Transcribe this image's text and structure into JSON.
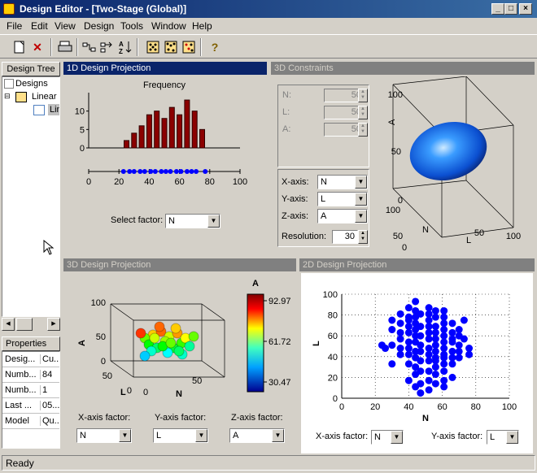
{
  "window": {
    "title": "Design Editor - [Two-Stage (Global)]",
    "minimize": "_",
    "maximize": "□",
    "close": "×"
  },
  "menu": [
    "File",
    "Edit",
    "View",
    "Design",
    "Tools",
    "Window",
    "Help"
  ],
  "tree": {
    "header": "Design Tree",
    "items": [
      "Designs",
      "Linear M",
      "Lin"
    ]
  },
  "properties": {
    "header": "Properties -...",
    "rows": [
      [
        "Desig...",
        "Cu..."
      ],
      [
        "Numb...",
        "84"
      ],
      [
        "Numb...",
        "1"
      ],
      [
        "Last ...",
        "05..."
      ],
      [
        "Model",
        "Qu..."
      ]
    ]
  },
  "panel_1d": {
    "title": "1D Design Projection",
    "select_label": "Select factor:",
    "select_value": "N"
  },
  "panel_3dc": {
    "title": "3D Constraints",
    "fields": [
      {
        "label": "N:",
        "value": "50"
      },
      {
        "label": "L:",
        "value": "50"
      },
      {
        "label": "A:",
        "value": "50"
      }
    ],
    "axes": [
      {
        "label": "X-axis:",
        "value": "N"
      },
      {
        "label": "Y-axis:",
        "value": "L"
      },
      {
        "label": "Z-axis:",
        "value": "A"
      }
    ],
    "resolution_label": "Resolution:",
    "resolution_value": "30"
  },
  "panel_3dp": {
    "title": "3D Design Projection",
    "factors": [
      {
        "label": "X-axis factor:",
        "value": "N"
      },
      {
        "label": "Y-axis factor:",
        "value": "L"
      },
      {
        "label": "Z-axis factor:",
        "value": "A"
      }
    ]
  },
  "panel_2dp": {
    "title": "2D Design Projection",
    "factors": [
      {
        "label": "X-axis factor:",
        "value": "N"
      },
      {
        "label": "Y-axis factor:",
        "value": "L"
      }
    ]
  },
  "status": "Ready",
  "colors": {
    "title_active": "#0a246a",
    "hist_bar": "#8b0000",
    "points": "#0000ff"
  },
  "chart_data": [
    {
      "type": "bar",
      "title": "Frequency",
      "x": [
        25,
        30,
        35,
        40,
        45,
        50,
        55,
        60,
        65,
        70,
        75
      ],
      "values": [
        2,
        4,
        6,
        9,
        10,
        8,
        11,
        9,
        13,
        10,
        5
      ],
      "xlim": [
        0,
        100
      ],
      "ylim": [
        0,
        15
      ],
      "xticks": [
        "0",
        "20",
        "40",
        "60",
        "80",
        "100"
      ],
      "yticks": [
        "0",
        "5",
        "10"
      ],
      "rug_x": [
        23,
        27,
        30,
        34,
        37,
        41,
        44,
        48,
        51,
        54,
        58,
        61,
        65,
        68,
        71,
        77
      ]
    },
    {
      "type": "scatter",
      "subtype": "surface-3d",
      "axis_labels": [
        "A",
        "N",
        "L"
      ],
      "ticks_a": [
        "100",
        "50",
        "0"
      ],
      "ticks_n": [
        "100",
        "50",
        "0"
      ],
      "ticks_l": [
        "50",
        "100"
      ]
    },
    {
      "type": "scatter",
      "subtype": "scatter-3d",
      "axis_labels": [
        "A",
        "L",
        "N"
      ],
      "ticks_a": [
        "100",
        "50",
        "0"
      ],
      "ticks_l": [
        "50",
        "0"
      ],
      "ticks_n": [
        "0",
        "50"
      ],
      "colorbar": {
        "label": "A",
        "ticks": [
          "92.97",
          "61.72",
          "30.47"
        ]
      }
    },
    {
      "type": "scatter",
      "xlabel": "N",
      "ylabel": "L",
      "xlim": [
        0,
        100
      ],
      "ylim": [
        0,
        100
      ],
      "xticks": [
        "0",
        "20",
        "40",
        "60",
        "80",
        "100"
      ],
      "yticks": [
        "0",
        "20",
        "40",
        "60",
        "80",
        "100"
      ],
      "points": [
        [
          44,
          93
        ],
        [
          40,
          87
        ],
        [
          52,
          87
        ],
        [
          44,
          84
        ],
        [
          56,
          84
        ],
        [
          61,
          84
        ],
        [
          35,
          81
        ],
        [
          47,
          81
        ],
        [
          52,
          81
        ],
        [
          40,
          78
        ],
        [
          44,
          78
        ],
        [
          56,
          78
        ],
        [
          61,
          78
        ],
        [
          30,
          75
        ],
        [
          40,
          75
        ],
        [
          52,
          75
        ],
        [
          73,
          75
        ],
        [
          35,
          72
        ],
        [
          44,
          72
        ],
        [
          61,
          72
        ],
        [
          66,
          72
        ],
        [
          40,
          69
        ],
        [
          47,
          69
        ],
        [
          52,
          69
        ],
        [
          56,
          69
        ],
        [
          30,
          66
        ],
        [
          44,
          66
        ],
        [
          61,
          66
        ],
        [
          70,
          66
        ],
        [
          35,
          63
        ],
        [
          40,
          63
        ],
        [
          52,
          63
        ],
        [
          56,
          63
        ],
        [
          66,
          63
        ],
        [
          44,
          60
        ],
        [
          47,
          60
        ],
        [
          61,
          60
        ],
        [
          70,
          60
        ],
        [
          35,
          57
        ],
        [
          52,
          57
        ],
        [
          56,
          57
        ],
        [
          66,
          57
        ],
        [
          73,
          57
        ],
        [
          40,
          54
        ],
        [
          44,
          54
        ],
        [
          61,
          54
        ],
        [
          66,
          54
        ],
        [
          24,
          51
        ],
        [
          30,
          51
        ],
        [
          47,
          51
        ],
        [
          56,
          51
        ],
        [
          70,
          51
        ],
        [
          26,
          48
        ],
        [
          35,
          48
        ],
        [
          40,
          48
        ],
        [
          52,
          48
        ],
        [
          61,
          48
        ],
        [
          76,
          48
        ],
        [
          44,
          45
        ],
        [
          47,
          45
        ],
        [
          56,
          45
        ],
        [
          66,
          45
        ],
        [
          70,
          45
        ],
        [
          35,
          42
        ],
        [
          40,
          42
        ],
        [
          52,
          42
        ],
        [
          61,
          42
        ],
        [
          76,
          42
        ],
        [
          44,
          39
        ],
        [
          56,
          39
        ],
        [
          61,
          39
        ],
        [
          66,
          39
        ],
        [
          70,
          39
        ],
        [
          47,
          36
        ],
        [
          52,
          36
        ],
        [
          56,
          36
        ],
        [
          30,
          33
        ],
        [
          40,
          33
        ],
        [
          61,
          33
        ],
        [
          66,
          33
        ],
        [
          44,
          30
        ],
        [
          56,
          30
        ],
        [
          47,
          26
        ],
        [
          52,
          26
        ],
        [
          61,
          26
        ],
        [
          44,
          23
        ],
        [
          56,
          23
        ],
        [
          66,
          20
        ],
        [
          40,
          17
        ],
        [
          52,
          17
        ],
        [
          61,
          17
        ],
        [
          47,
          14
        ],
        [
          56,
          14
        ],
        [
          44,
          11
        ],
        [
          61,
          11
        ],
        [
          52,
          8
        ],
        [
          47,
          5
        ]
      ]
    }
  ]
}
